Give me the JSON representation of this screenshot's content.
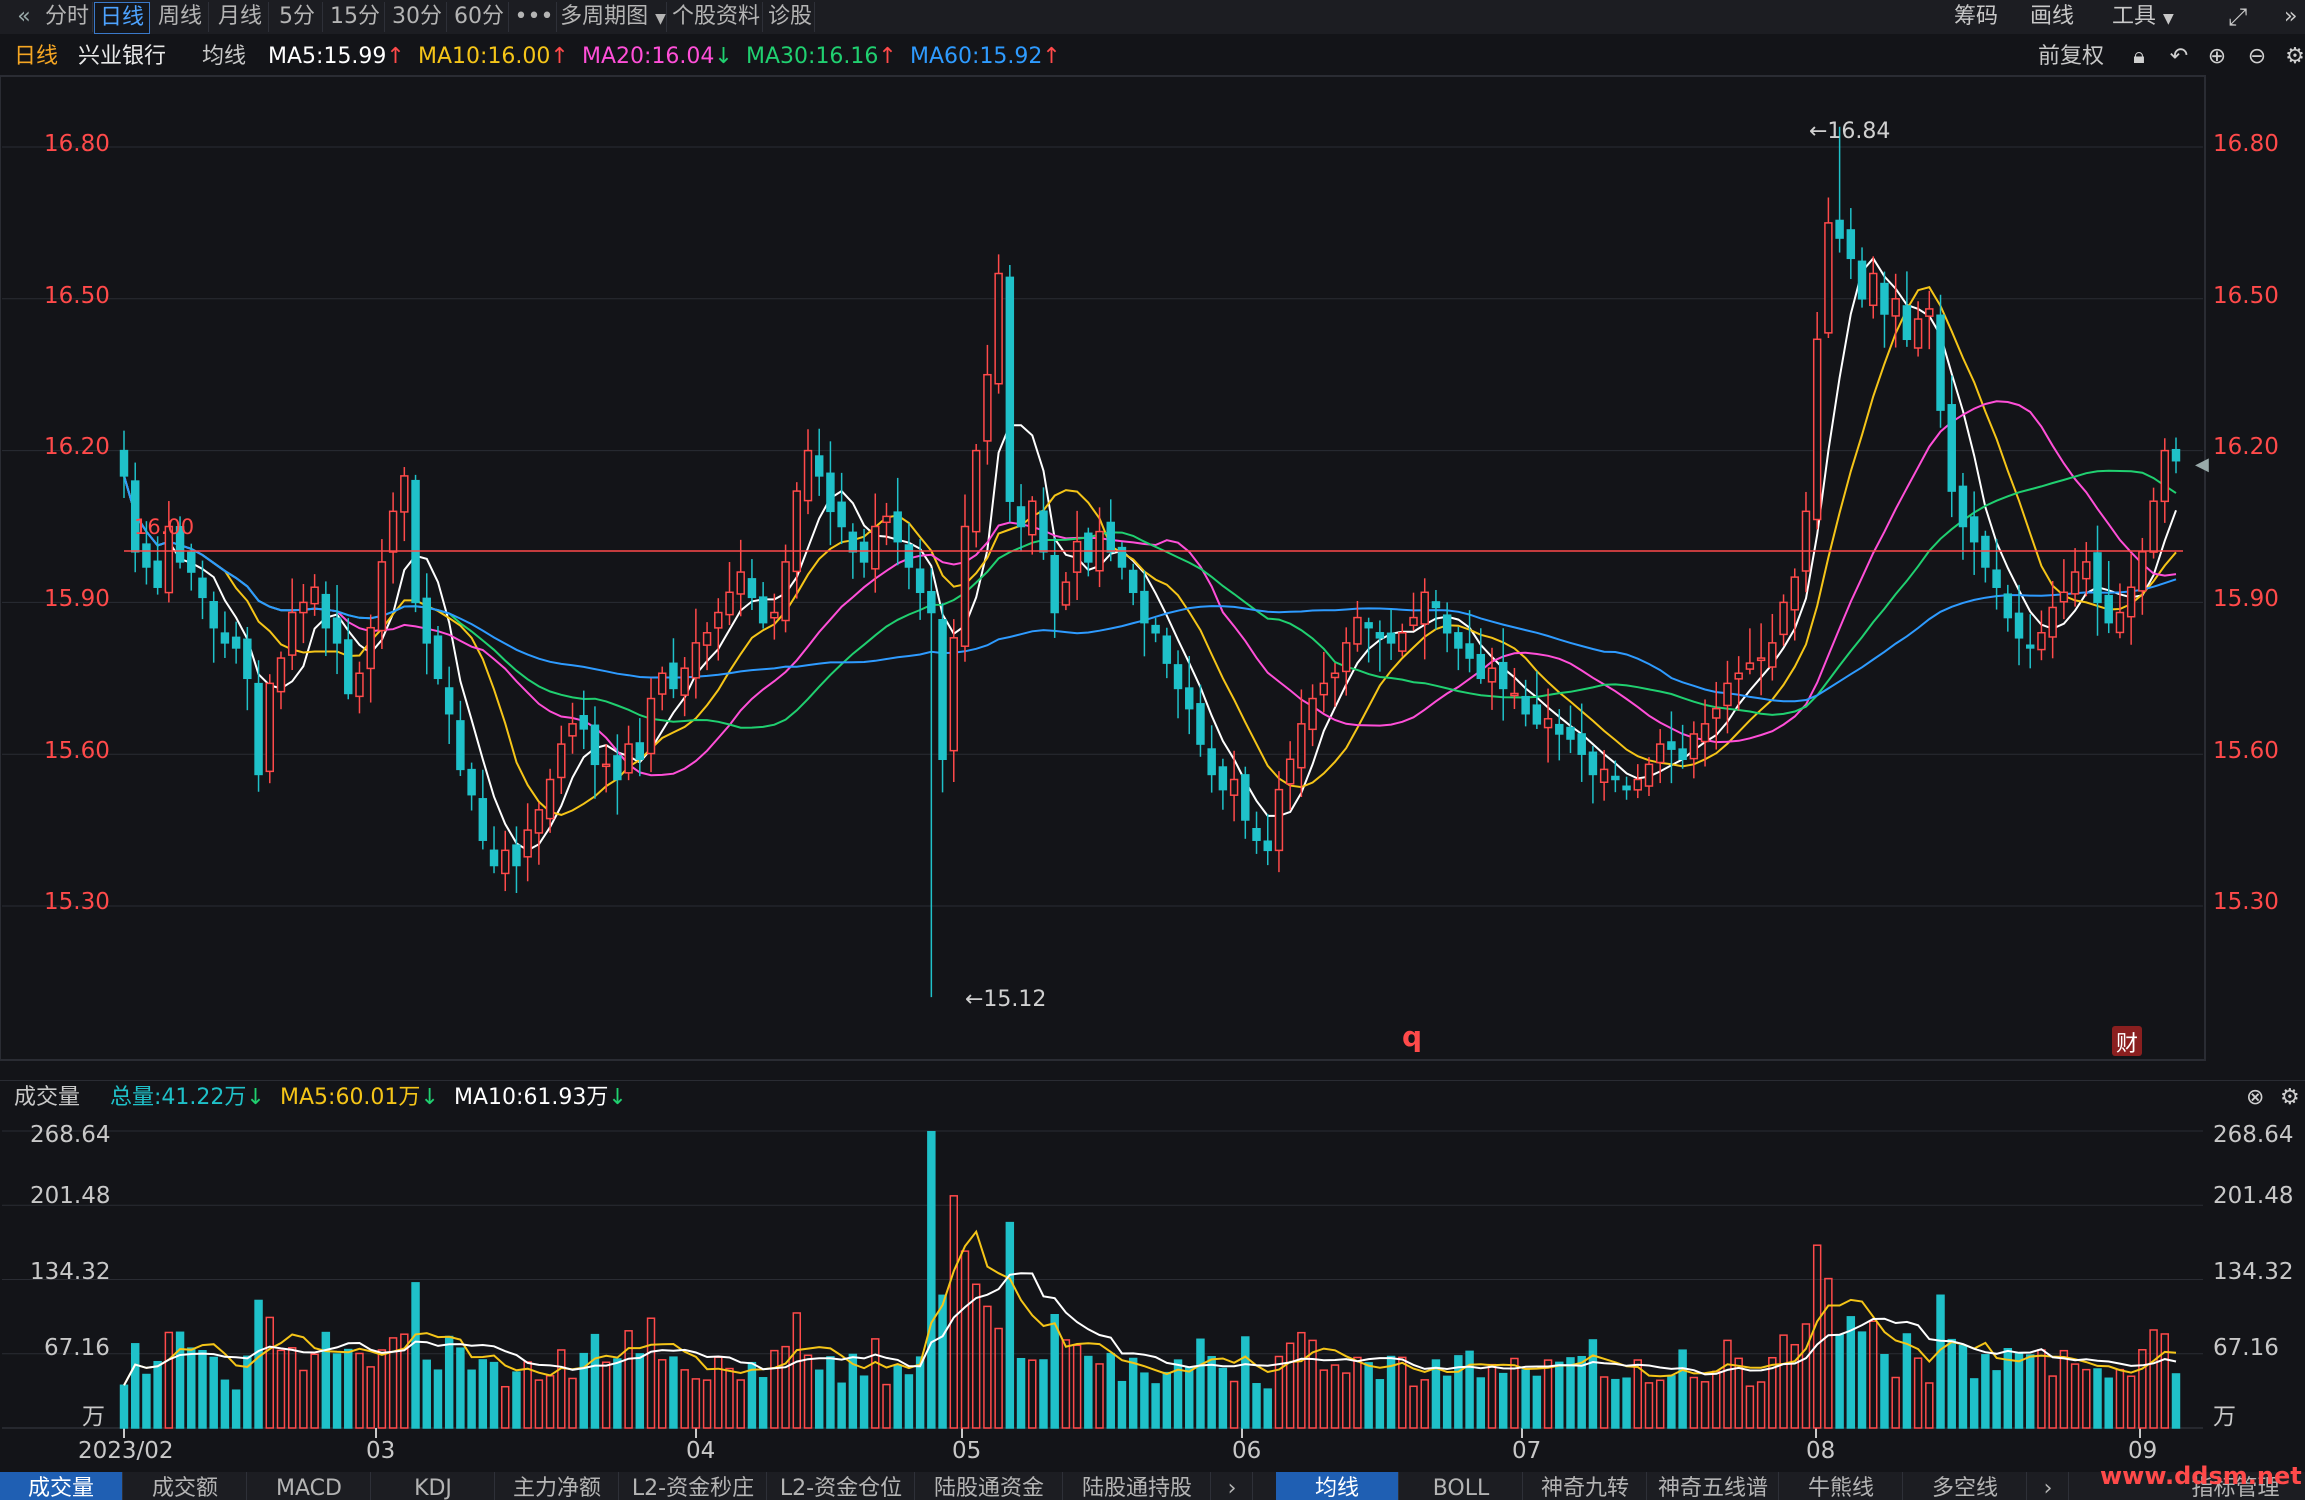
{
  "toolbar": {
    "back_icon": "double-chevron-left-icon",
    "tabs": [
      "分时",
      "日线",
      "周线",
      "月线",
      "5分",
      "15分",
      "30分",
      "60分",
      "•••",
      "多周期图",
      "个股资料",
      "诊股"
    ],
    "active_tab": "日线",
    "right": {
      "chips": "筹码",
      "draw": "画线",
      "tools": "工具"
    },
    "expand_icon": "fullscreen-icon"
  },
  "info": {
    "period": "日线",
    "stock_name": "兴业银行",
    "ma_label": "均线",
    "ma5": "MA5:15.99",
    "ma10": "MA10:16.00",
    "ma20": "MA20:16.04",
    "ma30": "MA30:16.16",
    "ma60": "MA60:15.92",
    "adjust": "前复权",
    "colors": {
      "ma5": "#ffffff",
      "ma10": "#f5c518",
      "ma20": "#ff4fd8",
      "ma30": "#20d070",
      "ma60": "#2e9bff",
      "up": "#ff4a4a",
      "down": "#1fc1c9"
    }
  },
  "main_chart": {
    "y_ticks": [
      "16.80",
      "16.50",
      "16.20",
      "15.90",
      "15.60",
      "15.30"
    ],
    "ref_line_label": "16.00",
    "high_label": "←16.84",
    "low_label": "←15.12",
    "q_marker": "q",
    "cai_badge": "财"
  },
  "volume": {
    "title": "成交量",
    "total": "总量:41.22万",
    "ma5": "MA5:60.01万",
    "ma10": "MA10:61.93万",
    "y_ticks": [
      "268.64",
      "201.48",
      "134.32",
      "67.16"
    ],
    "unit": "万"
  },
  "x_axis": [
    "2023/02",
    "03",
    "04",
    "05",
    "06",
    "07",
    "08",
    "09"
  ],
  "bottom_tabs_left": [
    "成交量",
    "成交额",
    "MACD",
    "KDJ",
    "主力净额",
    "L2-资金秒庄",
    "L2-资金仓位",
    "陆股通资金",
    "陆股通持股"
  ],
  "bottom_tabs_right": [
    "均线",
    "BOLL",
    "神奇九转",
    "神奇五线谱",
    "牛熊线",
    "多空线"
  ],
  "bottom_right_label": "指标管理",
  "watermark": "www.ddsm.net",
  "chart_data": {
    "type": "candlestick",
    "price_range": [
      15.05,
      16.92
    ],
    "volume_range": [
      0,
      268.64
    ],
    "closes": [
      16.15,
      16.0,
      15.97,
      15.93,
      16.05,
      15.98,
      15.96,
      15.91,
      15.85,
      15.82,
      15.81,
      15.75,
      15.56,
      15.74,
      15.79,
      15.88,
      15.9,
      15.93,
      15.85,
      15.82,
      15.72,
      15.76,
      15.85,
      15.98,
      16.08,
      16.15,
      15.9,
      15.82,
      15.75,
      15.68,
      15.57,
      15.52,
      15.43,
      15.38,
      15.41,
      15.38,
      15.45,
      15.49,
      15.55,
      15.62,
      15.66,
      15.65,
      15.58,
      15.58,
      15.55,
      15.62,
      15.59,
      15.71,
      15.76,
      15.73,
      15.77,
      15.82,
      15.84,
      15.88,
      15.92,
      15.96,
      15.91,
      15.86,
      15.88,
      15.98,
      16.12,
      16.2,
      16.15,
      16.08,
      16.05,
      16.0,
      15.98,
      16.05,
      16.07,
      16.02,
      15.97,
      15.92,
      15.88,
      15.59,
      15.83,
      16.05,
      16.2,
      16.35,
      16.55,
      16.1,
      16.05,
      16.1,
      16.0,
      15.88,
      15.94,
      16.02,
      15.98,
      16.04,
      16.0,
      15.97,
      15.92,
      15.86,
      15.84,
      15.78,
      15.73,
      15.69,
      15.62,
      15.56,
      15.53,
      15.55,
      15.47,
      15.43,
      15.41,
      15.53,
      15.59,
      15.66,
      15.71,
      15.74,
      15.76,
      15.82,
      15.87,
      15.85,
      15.83,
      15.82,
      15.84,
      15.87,
      15.92,
      15.89,
      15.84,
      15.81,
      15.79,
      15.75,
      15.77,
      15.73,
      15.72,
      15.68,
      15.66,
      15.67,
      15.64,
      15.63,
      15.6,
      15.56,
      15.57,
      15.55,
      15.53,
      15.55,
      15.58,
      15.62,
      15.61,
      15.59,
      15.64,
      15.66,
      15.69,
      15.74,
      15.76,
      15.78,
      15.79,
      15.82,
      15.9,
      15.95,
      16.08,
      16.42,
      16.65,
      16.62,
      16.58,
      16.5,
      16.55,
      16.47,
      16.5,
      16.42,
      16.46,
      16.48,
      16.28,
      16.12,
      16.05,
      16.02,
      15.97,
      15.93,
      15.87,
      15.83,
      15.81,
      15.84,
      15.89,
      15.92,
      15.96,
      15.98,
      15.9,
      15.86,
      15.88,
      15.93,
      16.0,
      16.1,
      16.2,
      16.18
    ]
  }
}
